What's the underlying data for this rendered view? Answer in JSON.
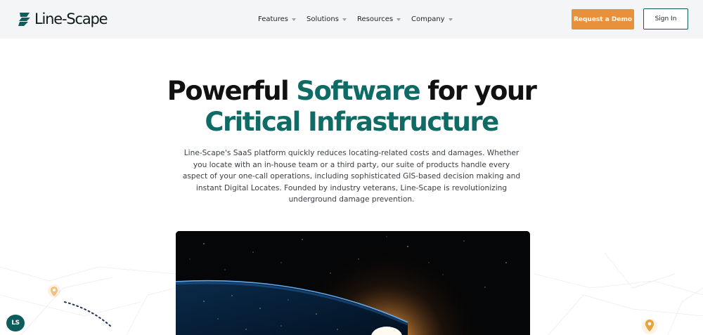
{
  "header": {
    "logo_text": "Line-Scape",
    "nav": [
      {
        "label": "Features"
      },
      {
        "label": "Solutions"
      },
      {
        "label": "Resources"
      },
      {
        "label": "Company"
      }
    ],
    "request_demo_label": "Request a Demo",
    "sign_in_label": "Sign In"
  },
  "hero": {
    "title_part1": "Powerful ",
    "title_accent1": "Software",
    "title_part2": " for your",
    "title_accent2": "Critical Infrastructure",
    "body": "Line-Scape's SaaS platform quickly reduces locating-related costs and damages. Whether you locate with an in-house team or a third party, our suite of products handle every aspect of your one-call operations, including sophisticated GIS-based decision making and instant Digital Locates. Founded by industry veterans, Line-Scape is revolutionizing underground damage prevention."
  },
  "chat_badge": {
    "label": "LS"
  },
  "colors": {
    "brand_teal": "#0f6b66",
    "accent_orange": "#e8913a",
    "pin_orange": "#e9a13b"
  }
}
